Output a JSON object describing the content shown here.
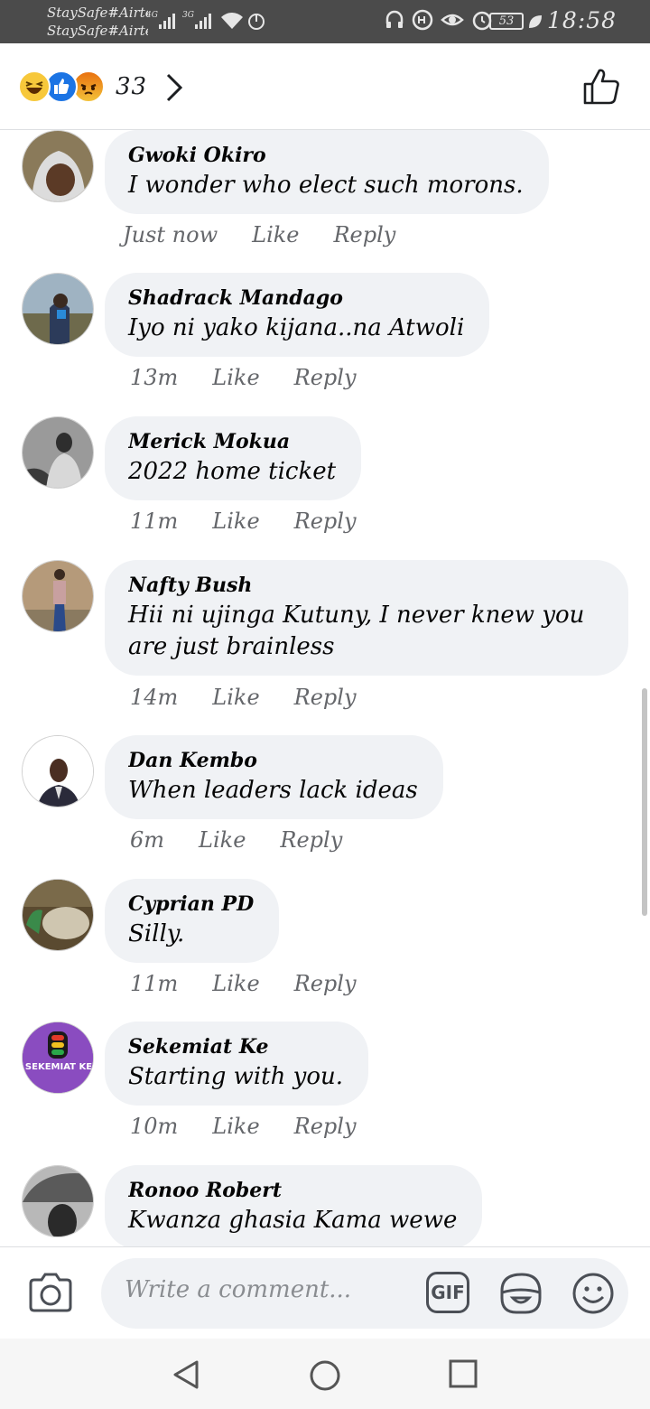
{
  "status_bar": {
    "carrier_1": "StaySafe#Airtel",
    "carrier_2": "StaySafe#Airtel",
    "network_1": "4G",
    "network_2": "3G",
    "battery": "53",
    "time": "18:58"
  },
  "reactions": {
    "types": [
      "haha-icon",
      "like-icon",
      "angry-icon"
    ],
    "count": "33"
  },
  "comments": [
    {
      "author": "Gwoki Okiro",
      "text": "I wonder who elect such morons.",
      "time": "Just now",
      "like": "Like",
      "reply": "Reply"
    },
    {
      "author": "Shadrack Mandago",
      "text": "Iyo ni yako kijana..na Atwoli",
      "time": "13m",
      "like": "Like",
      "reply": "Reply"
    },
    {
      "author": "Merick Mokua",
      "text": "2022 home ticket",
      "time": "11m",
      "like": "Like",
      "reply": "Reply"
    },
    {
      "author": "Nafty Bush",
      "text": "Hii ni ujinga Kutuny, I never knew you are just brainless",
      "time": "14m",
      "like": "Like",
      "reply": "Reply"
    },
    {
      "author": "Dan Kembo",
      "text": "When leaders lack ideas",
      "time": "6m",
      "like": "Like",
      "reply": "Reply"
    },
    {
      "author": "Cyprian PD",
      "text": "Silly.",
      "time": "11m",
      "like": "Like",
      "reply": "Reply"
    },
    {
      "author": "Sekemiat Ke",
      "text": "Starting with you.",
      "time": "10m",
      "like": "Like",
      "reply": "Reply",
      "avatar_label": "SEKEMIAT KE"
    },
    {
      "author": "Ronoo Robert",
      "text": "Kwanza ghasia Kama wewe",
      "time": "",
      "like": "",
      "reply": ""
    }
  ],
  "composer": {
    "placeholder": "Write a comment...",
    "gif_label": "GIF"
  },
  "colors": {
    "status_bar": "#4b4b4b",
    "bubble": "#f0f2f5",
    "meta_text": "#65676b",
    "like_blue": "#1b74e4"
  }
}
